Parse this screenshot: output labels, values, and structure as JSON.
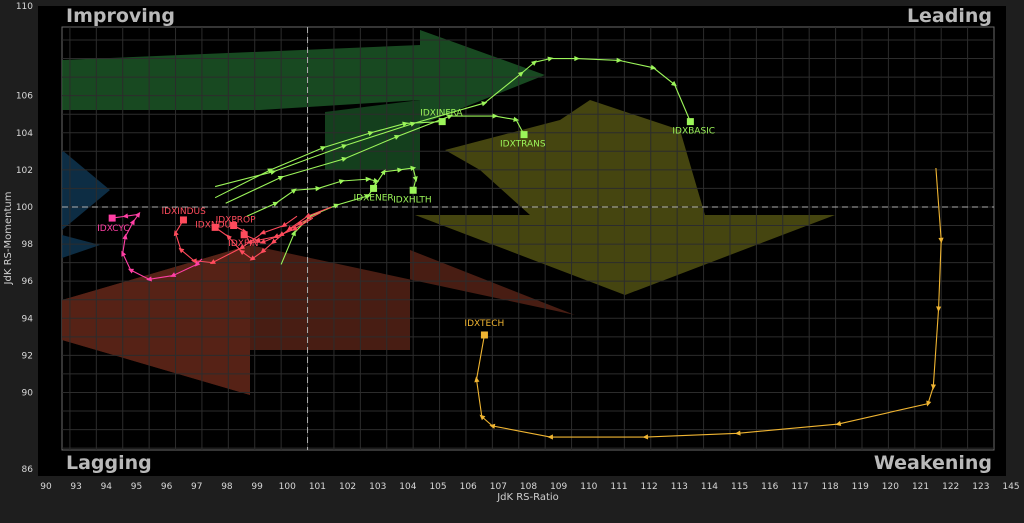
{
  "chart_data": {
    "type": "scatter",
    "xlabel": "JdK RS-Ratio",
    "ylabel": "JdK RS-Momentum",
    "xlim": [
      90.7,
      126
    ],
    "ylim": [
      86.9,
      109.7
    ],
    "xticks": [
      90,
      93,
      94,
      95,
      96,
      97,
      98,
      99,
      100,
      101,
      102,
      103,
      104,
      105,
      106,
      107,
      108,
      109,
      110,
      111,
      112,
      113,
      114,
      115,
      116,
      117,
      118,
      119,
      120,
      121,
      122,
      123,
      145
    ],
    "xtick_labels": [
      "90",
      "93",
      "94",
      "95",
      "96",
      "97",
      "98",
      "99",
      "100",
      "101",
      "102",
      "103",
      "104",
      "105",
      "106",
      "107",
      "108",
      "109",
      "110",
      "111",
      "112",
      "113",
      "114",
      "115",
      "116",
      "117",
      "118",
      "119",
      "120",
      "121",
      "122",
      "123",
      "145"
    ],
    "yticks": [
      86,
      90,
      92,
      94,
      96,
      98,
      100,
      102,
      104,
      106,
      110
    ],
    "ytick_labels": [
      "86",
      "90",
      "92",
      "94",
      "96",
      "98",
      "100",
      "102",
      "104",
      "106",
      "110"
    ],
    "center": {
      "x": 100,
      "y": 100
    },
    "grid": true,
    "quadrants": {
      "top_left": "Improving",
      "top_right": "Leading",
      "bottom_left": "Lagging",
      "bottom_right": "Weakening"
    },
    "series": [
      {
        "name": "IDXBASIC",
        "color": "#9cf55a",
        "points": [
          [
            96.5,
            101.1
          ],
          [
            98.7,
            101.9
          ],
          [
            101.4,
            103.3
          ],
          [
            104.0,
            104.5
          ],
          [
            106.7,
            105.6
          ],
          [
            108.1,
            107.2
          ],
          [
            108.6,
            107.8
          ],
          [
            109.2,
            108.0
          ],
          [
            110.2,
            108.0
          ],
          [
            111.8,
            107.9
          ],
          [
            113.1,
            107.5
          ],
          [
            113.9,
            106.6
          ],
          [
            114.5,
            104.6
          ]
        ]
      },
      {
        "name": "IDXINFRA",
        "color": "#9cf55a",
        "points": [
          [
            96.5,
            100.5
          ],
          [
            98.6,
            102.0
          ],
          [
            100.6,
            103.2
          ],
          [
            102.4,
            104.0
          ],
          [
            103.7,
            104.5
          ],
          [
            105.1,
            104.6
          ]
        ]
      },
      {
        "name": "IDXTRANS",
        "color": "#9cf55a",
        "points": [
          [
            96.9,
            100.2
          ],
          [
            99.0,
            101.6
          ],
          [
            101.4,
            102.6
          ],
          [
            103.4,
            103.8
          ],
          [
            105.4,
            104.9
          ],
          [
            107.1,
            104.9
          ],
          [
            107.9,
            104.7
          ],
          [
            108.2,
            103.9
          ]
        ]
      },
      {
        "name": "IDXENER",
        "color": "#9cf55a",
        "points": [
          [
            97.7,
            99.5
          ],
          [
            98.8,
            100.2
          ],
          [
            99.5,
            100.9
          ],
          [
            100.4,
            101.0
          ],
          [
            101.3,
            101.4
          ],
          [
            102.3,
            101.5
          ],
          [
            102.6,
            101.4
          ],
          [
            102.5,
            101.0
          ]
        ]
      },
      {
        "name": "IDXHLTH",
        "color": "#9cf55a",
        "points": [
          [
            99.0,
            96.9
          ],
          [
            99.5,
            98.6
          ],
          [
            100.1,
            99.5
          ],
          [
            101.1,
            100.1
          ],
          [
            102.3,
            100.6
          ],
          [
            102.9,
            101.9
          ],
          [
            103.5,
            102.0
          ],
          [
            104.0,
            102.1
          ],
          [
            104.1,
            101.5
          ],
          [
            104.0,
            100.9
          ]
        ]
      },
      {
        "name": "IDXTECH",
        "color": "#f0b532",
        "points": [
          [
            123.8,
            102.1
          ],
          [
            124.0,
            98.2
          ],
          [
            123.9,
            94.5
          ],
          [
            123.7,
            90.3
          ],
          [
            123.5,
            89.4
          ],
          [
            120.1,
            88.3
          ],
          [
            116.3,
            87.8
          ],
          [
            112.8,
            87.6
          ],
          [
            109.2,
            87.6
          ],
          [
            107.0,
            88.2
          ],
          [
            106.6,
            88.7
          ],
          [
            106.4,
            90.7
          ],
          [
            106.7,
            93.1
          ]
        ]
      },
      {
        "name": "IDXNDUS",
        "color": "#ff4b5c",
        "points": [
          [
            100.9,
            100.0
          ],
          [
            100.0,
            99.5
          ],
          [
            99.3,
            98.8
          ],
          [
            98.7,
            98.1
          ],
          [
            98.3,
            97.6
          ],
          [
            97.9,
            97.2
          ],
          [
            97.5,
            97.6
          ],
          [
            97.0,
            98.4
          ],
          [
            96.5,
            98.9
          ]
        ]
      },
      {
        "name": "IDXPROP",
        "color": "#ff4b5c",
        "points": [
          [
            100.5,
            99.7
          ],
          [
            99.7,
            99.1
          ],
          [
            99.0,
            98.5
          ],
          [
            98.3,
            98.1
          ],
          [
            97.8,
            98.1
          ],
          [
            97.6,
            98.7
          ],
          [
            97.2,
            99.0
          ]
        ]
      },
      {
        "name": "IDXFIN",
        "color": "#ff4b5c",
        "points": [
          [
            100.2,
            99.4
          ],
          [
            99.5,
            98.8
          ],
          [
            98.8,
            98.4
          ],
          [
            98.1,
            98.2
          ],
          [
            97.6,
            98.5
          ]
        ]
      },
      {
        "name": "IDXINDUS",
        "color": "#ff4b5c",
        "points": [
          [
            99.6,
            99.5
          ],
          [
            99.1,
            99.0
          ],
          [
            98.3,
            98.6
          ],
          [
            97.5,
            97.8
          ],
          [
            96.4,
            97.0
          ],
          [
            95.7,
            97.1
          ],
          [
            95.2,
            97.7
          ],
          [
            95.0,
            98.6
          ],
          [
            95.3,
            99.3
          ]
        ]
      },
      {
        "name": "IDXCYC",
        "color": "#ff3fa4",
        "points": [
          [
            96.0,
            97.2
          ],
          [
            95.8,
            96.9
          ],
          [
            94.9,
            96.3
          ],
          [
            94.0,
            96.1
          ],
          [
            93.3,
            96.6
          ],
          [
            93.0,
            97.5
          ],
          [
            93.1,
            98.4
          ],
          [
            93.4,
            99.2
          ],
          [
            93.6,
            99.6
          ],
          [
            93.1,
            99.5
          ],
          [
            92.6,
            99.4
          ]
        ]
      }
    ]
  }
}
